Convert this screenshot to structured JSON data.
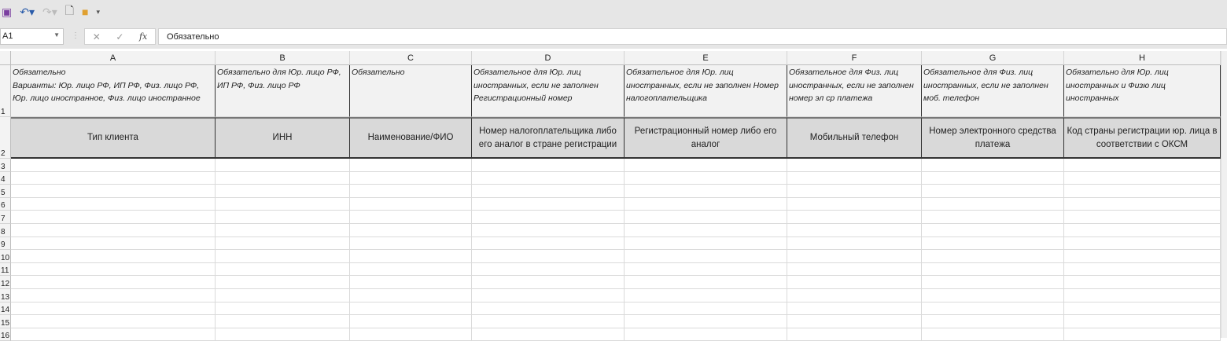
{
  "qat": {
    "icons": [
      "save-icon",
      "undo-icon",
      "redo-icon",
      "new-file-icon",
      "open-folder-icon",
      "customize-icon"
    ]
  },
  "formula_bar": {
    "name_box": "A1",
    "content": "Обязательно",
    "fx": "fx",
    "cancel": "✕",
    "enter": "✓"
  },
  "columns": [
    "A",
    "B",
    "C",
    "D",
    "E",
    "F",
    "G",
    "H"
  ],
  "rows": [
    "1",
    "2",
    "3",
    "4",
    "5",
    "6",
    "7",
    "8",
    "9",
    "10",
    "11",
    "12",
    "13",
    "14",
    "15",
    "16"
  ],
  "row1": [
    "Обязательно\nВарианты: Юр. лицо РФ, ИП РФ, Физ. лицо РФ, Юр. лицо иностранное, Физ. лицо иностранное",
    "Обязательно для Юр. лицо РФ, ИП РФ, Физ. лицо РФ",
    "Обязательно",
    "Обязательное для Юр. лиц иностранных, если не заполнен Регистрационный номер",
    "Обязательное для Юр. лиц иностранных, если не заполнен Номер налогоплательщика",
    "Обязательное для Физ. лиц иностранных, если не заполнен номер эл ср платежа",
    "Обязательное для Физ. лиц иностранных, если не заполнен моб. телефон",
    "Обязательно для Юр. лиц иностранных и Физю лиц иностранных"
  ],
  "row2": [
    "Тип клиента",
    "ИНН",
    "Наименование/ФИО",
    "Номер налогоплательщика либо его аналог в стране регистрации",
    "Регистрационный номер либо его аналог",
    "Мобильный телефон",
    "Номер электронного средства платежа",
    "Код страны регистрации юр. лица в соответствии с ОКСМ"
  ]
}
